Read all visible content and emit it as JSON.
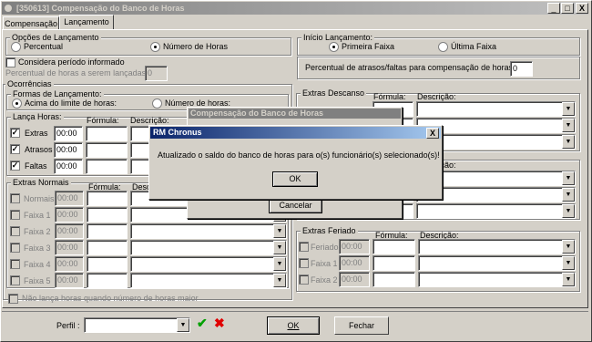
{
  "window": {
    "title": "[350613]  Compensação do Banco de Horas",
    "min": "_",
    "max": "□",
    "close": "X"
  },
  "tabs": [
    "Compensação",
    "Lançamento"
  ],
  "opcoes": {
    "title": "Opções de Lançamento",
    "percentual": "Percentual",
    "numero_horas": "Número de Horas",
    "considera": "Considera período informado",
    "perc_label": "Percentual de horas a serem lançadas:",
    "perc_value": "0"
  },
  "inicio": {
    "title": "Início Lançamento:",
    "primeira": "Primeira Faixa",
    "ultima": "Última Faixa",
    "atrasos_label": "Percentual de atrasos/faltas para compensação de horas:",
    "atrasos_value": "0"
  },
  "ocorrencias": {
    "title": "Ocorrências",
    "formas_title": "Formas de Lançamento:",
    "acima": "Acima do limite de horas:",
    "numero": "Número de horas:"
  },
  "lanca": {
    "title": "Lança Horas:",
    "formula": "Fórmula:",
    "descricao": "Descrição:",
    "rows": [
      {
        "label": "Extras",
        "value": "00:00"
      },
      {
        "label": "Atrasos",
        "value": "00:00"
      },
      {
        "label": "Faltas",
        "value": "00:00"
      }
    ]
  },
  "extras_normais": {
    "title": "Extras Normais",
    "formula": "Fórmula:",
    "descricao": "Descrição:",
    "rows": [
      {
        "label": "Normais",
        "value": "00:00"
      },
      {
        "label": "Faixa 1",
        "value": "00:00"
      },
      {
        "label": "Faixa 2",
        "value": "00:00"
      },
      {
        "label": "Faixa 3",
        "value": "00:00"
      },
      {
        "label": "Faixa 4",
        "value": "00:00"
      },
      {
        "label": "Faixa 5",
        "value": "00:00"
      }
    ]
  },
  "extras_descanso": {
    "title": "Extras Descanso",
    "formula": "Fórmula:",
    "descricao": "Descrição:"
  },
  "extras_x": {
    "descricao": "Descrição:"
  },
  "extras_feriado": {
    "title": "Extras Feriado",
    "formula": "Fórmula:",
    "descricao": "Descrição:",
    "rows": [
      {
        "label": "Feriado",
        "value": "00:00"
      },
      {
        "label": "Faixa 1",
        "value": "00:00"
      },
      {
        "label": "Faixa 2",
        "value": "00:00"
      }
    ]
  },
  "nao_lanca": "Não lança horas quando número de horas maior",
  "footer": {
    "perfil": "Perfil :",
    "ok": "OK",
    "fechar": "Fechar"
  },
  "progress_dialog": {
    "title": "Compensação do Banco de Horas",
    "cancel": "Cancelar"
  },
  "message_dialog": {
    "title": "RM Chronus",
    "close": "X",
    "message": "Atualizado o saldo do banco de horas para o(s) funcionário(s) selecionado(s)!",
    "ok": "OK"
  }
}
